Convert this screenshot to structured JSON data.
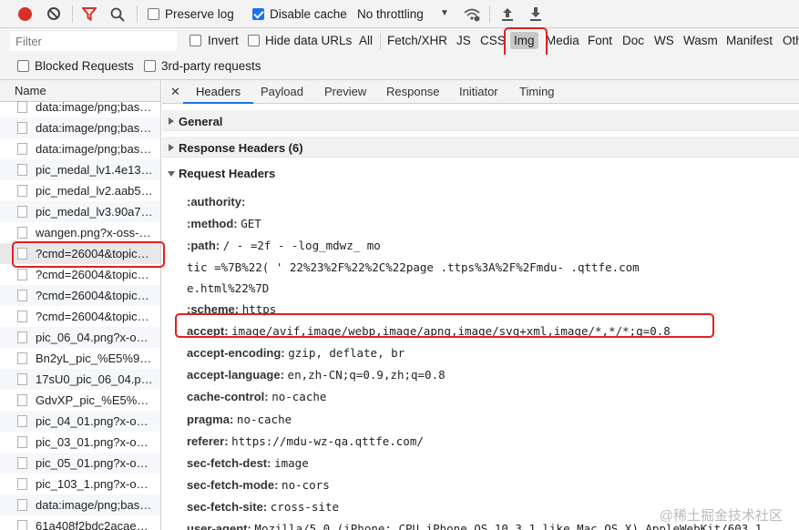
{
  "toolbar": {
    "preserve_log": "Preserve log",
    "disable_cache": "Disable cache",
    "throttling": "No throttling"
  },
  "filter": {
    "placeholder": "Filter",
    "invert": "Invert",
    "hide_data_urls": "Hide data URLs",
    "types": [
      "All",
      "Fetch/XHR",
      "JS",
      "CSS",
      "Img",
      "Media",
      "Font",
      "Doc",
      "WS",
      "Wasm",
      "Manifest",
      "Oth"
    ],
    "selected_type": "Img",
    "blocked": "Blocked Requests",
    "third_party": "3rd-party requests"
  },
  "requests": {
    "column": "Name",
    "items": [
      "data:image/png;bas…",
      "data:image/png;bas…",
      "data:image/png;bas…",
      "pic_medal_lv1.4e13…",
      "pic_medal_lv2.aab5…",
      "pic_medal_lv3.90a7…",
      "wangen.png?x-oss-…",
      "?cmd=26004&topic…",
      "?cmd=26004&topic…",
      "?cmd=26004&topic…",
      "?cmd=26004&topic…",
      "pic_06_04.png?x-o…",
      "Bn2yL_pic_%E5%9…",
      "17sU0_pic_06_04.p…",
      "GdvXP_pic_%E5%…",
      "pic_04_01.png?x-o…",
      "pic_03_01.png?x-o…",
      "pic_05_01.png?x-o…",
      "pic_103_1.png?x-o…",
      "data:image/png;bas…",
      "61a408f2bdc2acae…"
    ]
  },
  "details": {
    "close": "✕",
    "tabs": [
      "Headers",
      "Payload",
      "Preview",
      "Response",
      "Initiator",
      "Timing"
    ],
    "active_tab": "Headers",
    "sections": {
      "general": "General",
      "response": "Response Headers (6)",
      "request": "Request Headers"
    },
    "headers": [
      {
        "name": ":authority:",
        "value": ""
      },
      {
        "name": ":method:",
        "value": "GET"
      },
      {
        "name": ":path:",
        "value": "/  -  =2f              -  -log_mdwz_                                                              mo"
      },
      {
        "name": "",
        "value": "tic =%7B%22(      '       22%23%2F%22%2C%22page            .ttps%3A%2F%2Fmdu-     .qttfe.com"
      },
      {
        "name": "",
        "value": "e.html%22%7D"
      },
      {
        "name": ":scheme:",
        "value": "https"
      },
      {
        "name": "accept:",
        "value": "image/avif,image/webp,image/apng,image/svg+xml,image/*,*/*;q=0.8"
      },
      {
        "name": "accept-encoding:",
        "value": "gzip, deflate, br"
      },
      {
        "name": "accept-language:",
        "value": "en,zh-CN;q=0.9,zh;q=0.8"
      },
      {
        "name": "cache-control:",
        "value": "no-cache"
      },
      {
        "name": "pragma:",
        "value": "no-cache"
      },
      {
        "name": "referer:",
        "value": "https://mdu-wz-qa.qttfe.com/"
      },
      {
        "name": "sec-fetch-dest:",
        "value": "image"
      },
      {
        "name": "sec-fetch-mode:",
        "value": "no-cors"
      },
      {
        "name": "sec-fetch-site:",
        "value": "cross-site"
      },
      {
        "name": "user-agent:",
        "value": "Mozilla/5.0 (iPhone; CPU iPhone OS 10_3_1 like Mac OS X) AppleWebKit/603.1."
      }
    ]
  },
  "watermark": "@稀土掘金技术社区",
  "colors": {
    "accent": "#1a73e8",
    "highlight": "#e02020",
    "record": "#d93025"
  }
}
